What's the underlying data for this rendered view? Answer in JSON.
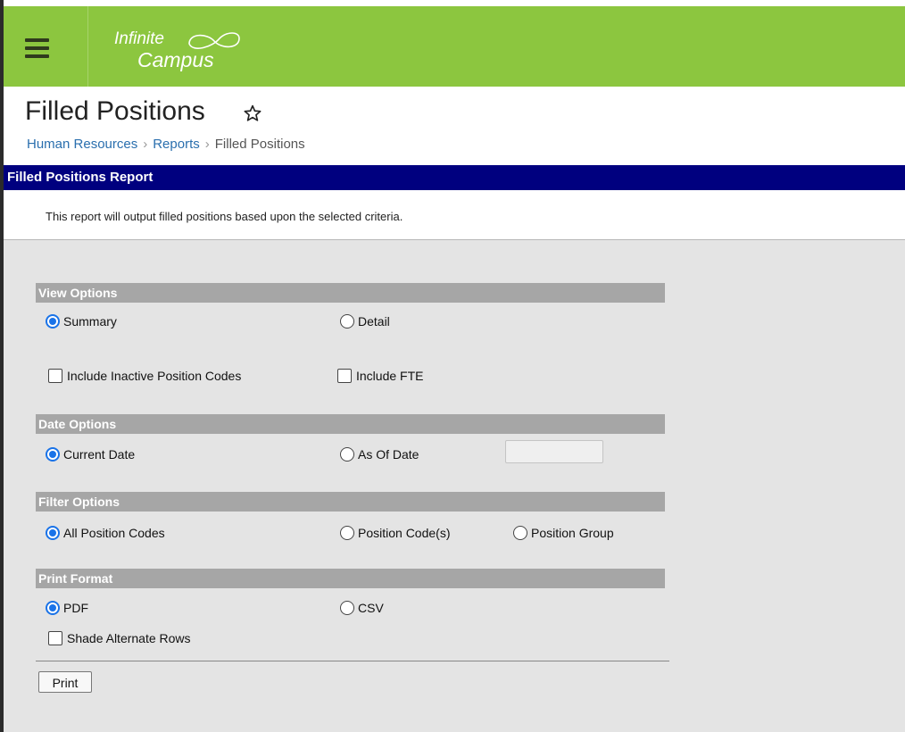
{
  "header": {
    "logo_line1": "Infinite",
    "logo_line2": "Campus",
    "brand_color": "#8cc63f",
    "menu_icon": "hamburger-menu-icon"
  },
  "page": {
    "title": "Filled Positions",
    "favorite_icon": "star-outline-icon",
    "breadcrumb": [
      "Human Resources",
      "Reports",
      "Filled Positions"
    ]
  },
  "report": {
    "header": "Filled Positions Report",
    "header_color": "#00007f",
    "description": "This report will output filled positions based upon the selected criteria."
  },
  "sections": {
    "view": {
      "title": "View Options",
      "summary": "Summary",
      "detail": "Detail",
      "selected": "Summary",
      "include_inactive": "Include Inactive Position Codes",
      "include_inactive_checked": false,
      "include_fte": "Include FTE",
      "include_fte_checked": false
    },
    "date": {
      "title": "Date Options",
      "current": "Current Date",
      "as_of": "As Of Date",
      "selected": "Current Date",
      "as_of_value": ""
    },
    "filter": {
      "title": "Filter Options",
      "all": "All Position Codes",
      "codes": "Position Code(s)",
      "group": "Position Group",
      "selected": "All Position Codes"
    },
    "print_format": {
      "title": "Print Format",
      "pdf": "PDF",
      "csv": "CSV",
      "selected": "PDF",
      "shade": "Shade Alternate Rows",
      "shade_checked": false
    }
  },
  "actions": {
    "print": "Print"
  }
}
